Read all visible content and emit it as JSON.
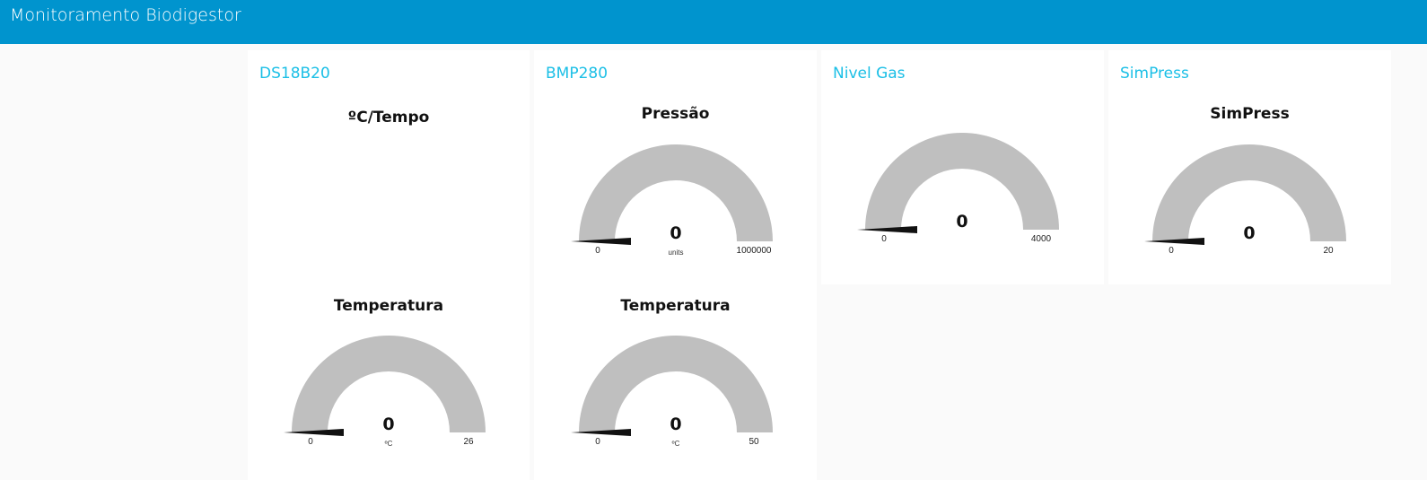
{
  "app": {
    "title": "Monitoramento Biodigestor"
  },
  "colors": {
    "toolbar": "#0094ce",
    "group_title": "#1bbfe6",
    "gauge_track": "#bfbfbf",
    "needle": "#111111"
  },
  "groups": [
    {
      "title": "DS18B20",
      "chart": {
        "title": "ºC/Tempo"
      },
      "gauge": {
        "title": "Temperatura",
        "value": "0",
        "min": "0",
        "max": "26",
        "units": "ºC"
      }
    },
    {
      "title": "BMP280",
      "gauge": {
        "title": "Pressão",
        "value": "0",
        "min": "0",
        "max": "1000000",
        "units": "units"
      },
      "gauge2": {
        "title": "Temperatura",
        "value": "0",
        "min": "0",
        "max": "50",
        "units": "ºC"
      }
    },
    {
      "title": "Nivel Gas",
      "gauge": {
        "value": "0",
        "min": "0",
        "max": "4000"
      }
    },
    {
      "title": "SimPress",
      "gauge": {
        "title": "SimPress",
        "value": "0",
        "min": "0",
        "max": "20"
      }
    }
  ]
}
